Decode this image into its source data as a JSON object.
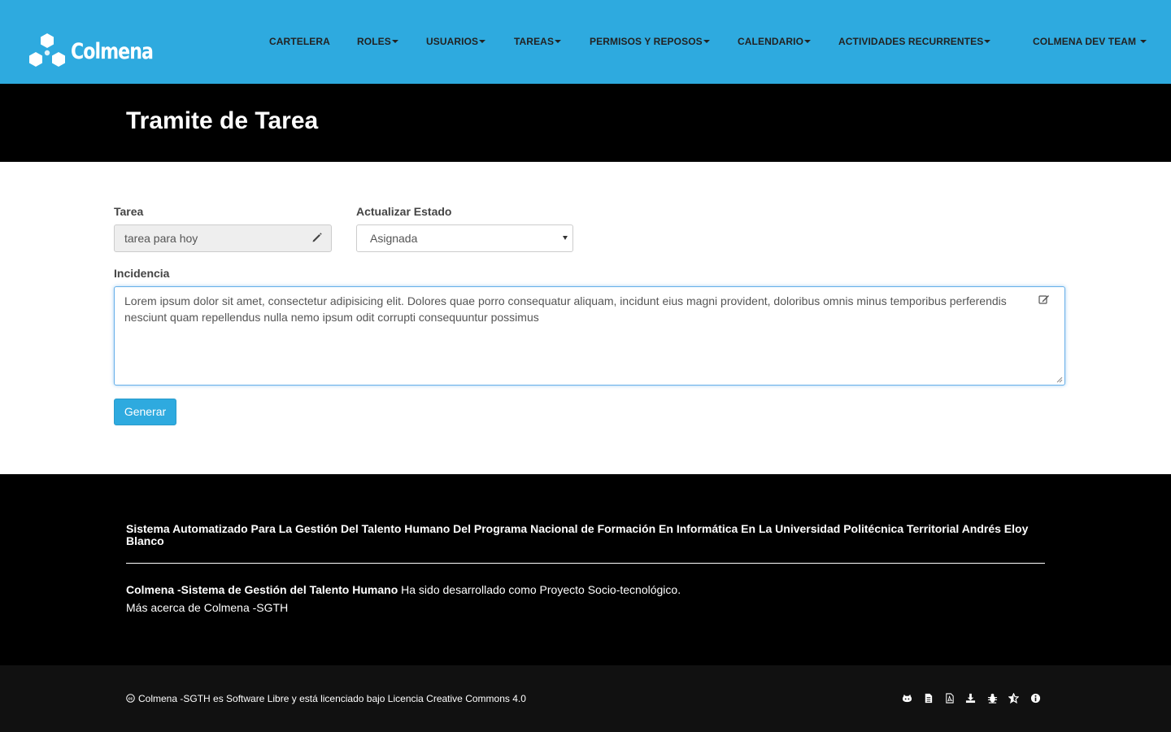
{
  "brand": {
    "name": "Colmena"
  },
  "nav": {
    "items": [
      {
        "label": "CARTELERA",
        "dropdown": false
      },
      {
        "label": "ROLES",
        "dropdown": true
      },
      {
        "label": "USUARIOS",
        "dropdown": true
      },
      {
        "label": "TAREAS",
        "dropdown": true
      },
      {
        "label": "PERMISOS Y REPOSOS",
        "dropdown": true
      },
      {
        "label": "CALENDARIO",
        "dropdown": true
      },
      {
        "label": "ACTIVIDADES RECURRENTES",
        "dropdown": true
      }
    ],
    "user_menu": "COLMENA DEV TEAM"
  },
  "page": {
    "title": "Tramite de Tarea"
  },
  "form": {
    "tarea_label": "Tarea",
    "tarea_value": "tarea para hoy",
    "estado_label": "Actualizar Estado",
    "estado_value": "Asignada",
    "incidencia_label": "Incidencia",
    "incidencia_value": "Lorem ipsum dolor sit amet, consectetur adipisicing elit. Dolores quae porro consequatur aliquam, incidunt eius magni provident, doloribus omnis minus temporibus perferendis nesciunt quam repellendus nulla nemo ipsum odit corrupti consequuntur possimus",
    "submit_label": "Generar"
  },
  "footer": {
    "heading": "Sistema Automatizado Para La Gestión Del Talento Humano Del Programa Nacional de Formación En Informática En La Universidad Politécnica Territorial Andrés Eloy Blanco",
    "system_name": "Colmena -Sistema de Gestión del Talento Humano",
    "system_desc": " Ha sido desarrollado como Proyecto Socio-tecnológico.",
    "more_link": "Más acerca de Colmena -SGTH",
    "license": "Colmena -SGTH es Software Libre y está licenciado bajo Licencia Creative Commons 4.0",
    "icons": [
      "github-icon",
      "document-icon",
      "pdf-icon",
      "download-icon",
      "bug-icon",
      "star-icon",
      "info-icon"
    ]
  },
  "colors": {
    "primary": "#2eaadf",
    "dark": "#000000",
    "footer_bottom": "#111111"
  }
}
